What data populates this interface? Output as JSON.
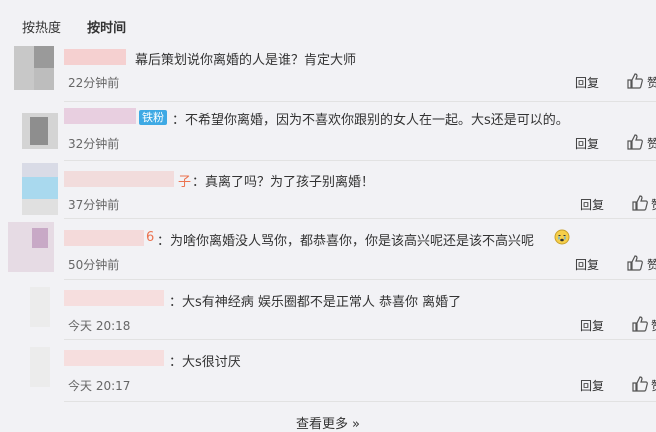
{
  "sort": {
    "hot": "按热度",
    "time": "按时间"
  },
  "comments": [
    {
      "name_tail": "",
      "badge": "",
      "text": "幕后策划说你离婚的人是谁？肯定大师",
      "time": "22分钟前",
      "reply": "回复",
      "like": "赞"
    },
    {
      "name_tail": "",
      "badge": "铁粉",
      "text": "：不希望你离婚，因为不喜欢你跟别的女人在一起。大s还是可以的。",
      "time": "32分钟前",
      "reply": "回复",
      "like": "赞"
    },
    {
      "name_tail": "子",
      "badge": "",
      "text": "：真离了吗？为了孩子别离婚！",
      "time": "37分钟前",
      "reply": "回复",
      "like": "赞"
    },
    {
      "name_tail": "6",
      "badge": "",
      "text": "：为啥你离婚没人骂你，都恭喜你，你是该高兴呢还是该不高兴呢",
      "time": "50分钟前",
      "reply": "回复",
      "like": "赞"
    },
    {
      "name_tail": "",
      "badge": "",
      "text": "：大s有神经病 娱乐圈都不是正常人 恭喜你 离婚了",
      "time": "今天 20:18",
      "reply": "回复",
      "like": "赞"
    },
    {
      "name_tail": "",
      "badge": "",
      "text": "：大s很讨厌",
      "time": "今天 20:17",
      "reply": "回复",
      "like": "赞"
    }
  ],
  "more": {
    "label": "查看更多",
    "chevron": "»"
  },
  "icons": {
    "like": "thumbs-up-icon",
    "cry": "crying-face-emoji"
  },
  "colors": {
    "name": "#eb7350",
    "badge": "#3ea9e4",
    "name_blur": "#f5d0d0"
  }
}
